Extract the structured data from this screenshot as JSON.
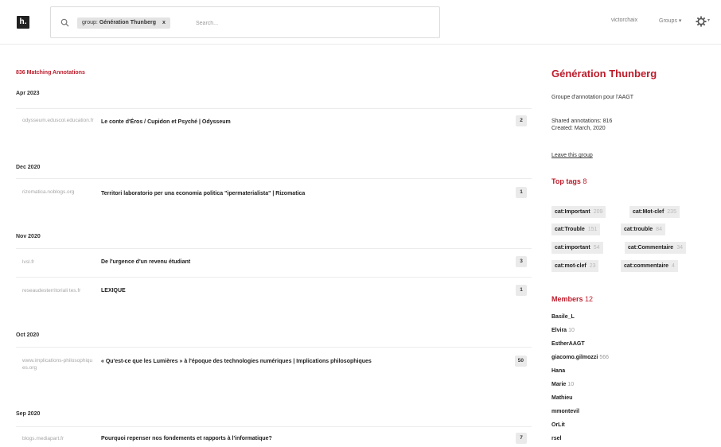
{
  "header": {
    "logo": "h.",
    "search_chip_key": "group:",
    "search_chip_value": "Génération Thunberg",
    "search_chip_remove": "x",
    "search_placeholder": "Search...",
    "username": "victorchaix",
    "groups_menu": "Groups ▾"
  },
  "results": {
    "count": "836",
    "count_label": "Matching Annotations",
    "months": [
      {
        "label": "Apr 2023"
      },
      {
        "label": "Dec 2020"
      },
      {
        "label": "Nov 2020"
      },
      {
        "label": "Oct 2020"
      },
      {
        "label": "Sep 2020"
      }
    ],
    "rows": [
      {
        "domain": "odysseum.eduscol.education.fr",
        "title": "Le conte d'Éros / Cupidon et Psyché | Odysseum",
        "count": "2"
      },
      {
        "domain": "rizomatica.noblogs.org",
        "title": "Territori laboratorio per una economia politica \"ipermaterialista\" | Rizomatica",
        "count": "1"
      },
      {
        "domain": "lvsl.fr",
        "title": "De l'urgence d'un revenu étudiant",
        "count": "3"
      },
      {
        "domain": "reseaudesterritoriali tes.fr",
        "title": "LEXIQUE",
        "count": "1"
      },
      {
        "domain": "www.implications-philosophiques.org",
        "title": "« Qu'est-ce que les Lumières » à l'époque des technologies numériques | Implications philosophiques",
        "count": "50"
      },
      {
        "domain": "blogs.mediapart.fr",
        "title": "Pourquoi repenser nos fondements et rapports à l'informatique?",
        "count": "7"
      }
    ]
  },
  "sidebar": {
    "title": "Génération Thunberg",
    "description": "Groupe d'annotation pour l'AAGT",
    "shared_annotations": "Shared annotations: 816",
    "created": "Created: March, 2020",
    "leave_link": "Leave this group",
    "tags_heading": "Top tags",
    "tags_count": "8",
    "tags": [
      {
        "name": "cat:Important",
        "count": "209"
      },
      {
        "name": "cat:Mot-clef",
        "count": "235"
      },
      {
        "name": "cat:Trouble",
        "count": "151"
      },
      {
        "name": "cat:trouble",
        "count": "84"
      },
      {
        "name": "cat:important",
        "count": "54"
      },
      {
        "name": "cat:Commentaire",
        "count": "34"
      },
      {
        "name": "cat:mot-clef",
        "count": "23"
      },
      {
        "name": "cat:commentaire",
        "count": "4"
      }
    ],
    "members_heading": "Members",
    "members_count": "12",
    "members": [
      {
        "name": "Basile_L",
        "count": ""
      },
      {
        "name": "Elvira",
        "count": "10"
      },
      {
        "name": "EstherAAGT",
        "count": ""
      },
      {
        "name": "giacomo.gilmozzi",
        "count": "566"
      },
      {
        "name": "Hana",
        "count": ""
      },
      {
        "name": "Marie",
        "count": "10"
      },
      {
        "name": "Mathieu",
        "count": ""
      },
      {
        "name": "mmontevil",
        "count": ""
      },
      {
        "name": "OrLit",
        "count": ""
      },
      {
        "name": "rsel",
        "count": ""
      }
    ]
  },
  "colors": {
    "accent": "#bd1c2b",
    "text": "#202020",
    "muted": "#a6a6a6",
    "chip": "#e4e4e4"
  }
}
